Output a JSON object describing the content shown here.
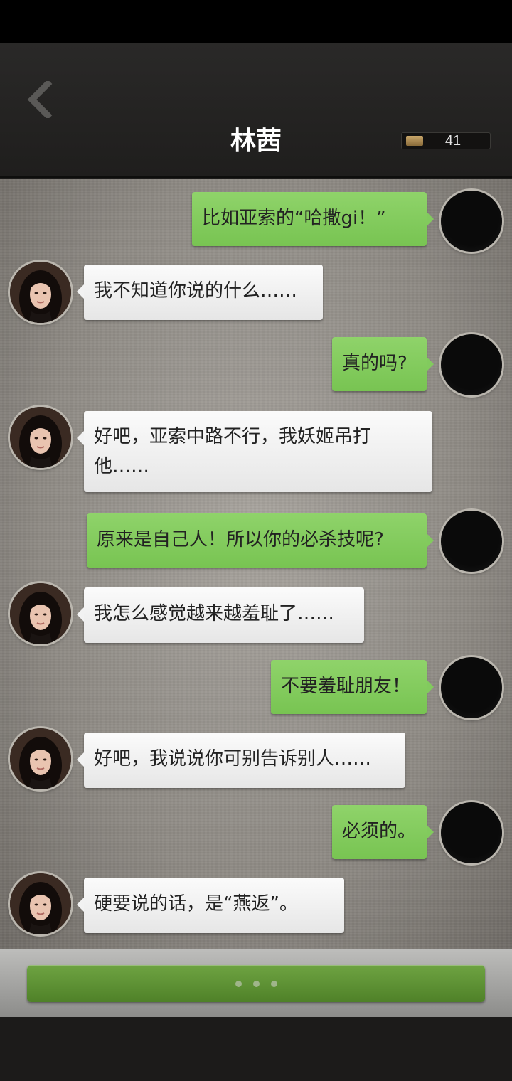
{
  "header": {
    "back_icon": "chevron-left-icon",
    "title": "林茜",
    "coin_icon": "coin-icon",
    "coin_count": "41"
  },
  "messages": [
    {
      "from": "me",
      "text": "比如亚索的“哈撒gi！”"
    },
    {
      "from": "her",
      "text": "我不知道你说的什么……"
    },
    {
      "from": "me",
      "text": "真的吗?"
    },
    {
      "from": "her",
      "text": "好吧，亚索中路不行，我妖姬吊打他……"
    },
    {
      "from": "me",
      "text": "原来是自己人！所以你的必杀技呢?"
    },
    {
      "from": "her",
      "text": "我怎么感觉越来越羞耻了……"
    },
    {
      "from": "me",
      "text": "不要羞耻朋友！"
    },
    {
      "from": "her",
      "text": "好吧，我说说你可别告诉别人……"
    },
    {
      "from": "me",
      "text": "必须的。"
    },
    {
      "from": "her",
      "text": "硬要说的话，是“燕返”。"
    }
  ],
  "footer": {
    "continue_icon": "typing-dots-icon"
  },
  "colors": {
    "my_bubble": "#82ca5e",
    "her_bubble": "#f2f2f2",
    "button": "#5e9235"
  }
}
